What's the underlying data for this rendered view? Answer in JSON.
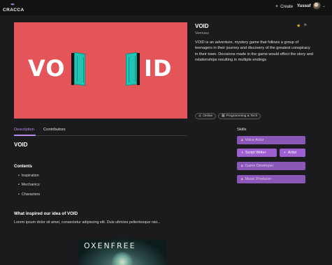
{
  "nav": {
    "logo_text": "CRACCA",
    "create_label": "Create",
    "username": "Yussuf"
  },
  "project": {
    "title": "VOID",
    "author": "Vemuez",
    "description": "VOID is an adventure, mystery game that follows a group of teenagers in their journey and discovery of the greatest conspiracy in their town. Decisions made in the game would effect the story and relationships resulting in multiple endings",
    "hero_left_word": "VO",
    "hero_right_word": "ID",
    "tags": [
      {
        "icon": "globe-icon",
        "label": "Online"
      },
      {
        "icon": "grid-icon",
        "label": "Programming & Tech"
      }
    ],
    "starred": true
  },
  "tabs": [
    {
      "label": "Description",
      "active": true
    },
    {
      "label": "Contributors",
      "active": false
    }
  ],
  "description": {
    "heading": "VOID",
    "contents_heading": "Contents",
    "contents": [
      "Inspiration",
      "Mechanics",
      "Characters"
    ],
    "inspired_heading": "What inspired our idea of VOID",
    "lorem": "Lorem ipsum dolor sit amet, consectetur adipiscing elit. Duis ultricies pellentesque nisi...",
    "image_text": "OXENFREE"
  },
  "skills": {
    "heading": "Skills",
    "items": [
      {
        "label": "Voice Actor",
        "state": "locked"
      },
      {
        "label": "Script Writer",
        "state": "open"
      },
      {
        "label": "Artist",
        "state": "open"
      },
      {
        "label": "Game Developer",
        "state": "locked"
      },
      {
        "label": "Music Producer",
        "state": "locked"
      }
    ]
  },
  "colors": {
    "accent": "#b98ae8",
    "skill_bg": "#8b58b8",
    "hero_bg": "#e4555a",
    "door": "#20c5b4",
    "star": "#f0b31f"
  }
}
